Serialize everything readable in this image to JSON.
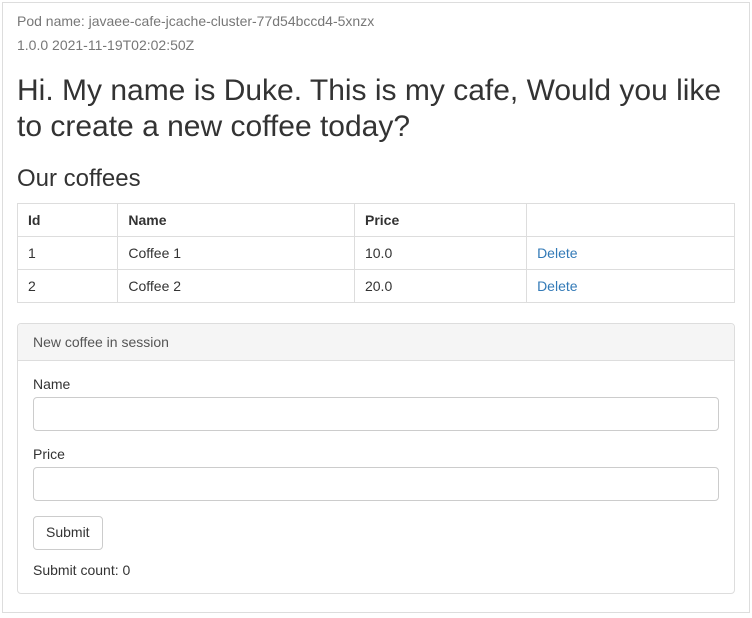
{
  "header": {
    "pod_name_prefix": "Pod name: ",
    "pod_name": "javaee-cafe-jcache-cluster-77d54bccd4-5xnzx",
    "version": "1.0.0 2021-11-19T02:02:50Z"
  },
  "intro": "Hi. My name is Duke. This is my cafe, Would you like to create a new coffee today?",
  "subhead": "Our coffees",
  "table": {
    "columns": [
      "Id",
      "Name",
      "Price",
      ""
    ],
    "rows": [
      {
        "id": "1",
        "name": "Coffee 1",
        "price": "10.0",
        "action": "Delete"
      },
      {
        "id": "2",
        "name": "Coffee 2",
        "price": "20.0",
        "action": "Delete"
      }
    ]
  },
  "form": {
    "panel_title": "New coffee in session",
    "name_label": "Name",
    "name_value": "",
    "price_label": "Price",
    "price_value": "",
    "submit_label": "Submit",
    "submit_count_prefix": "Submit count: ",
    "submit_count": "0"
  }
}
